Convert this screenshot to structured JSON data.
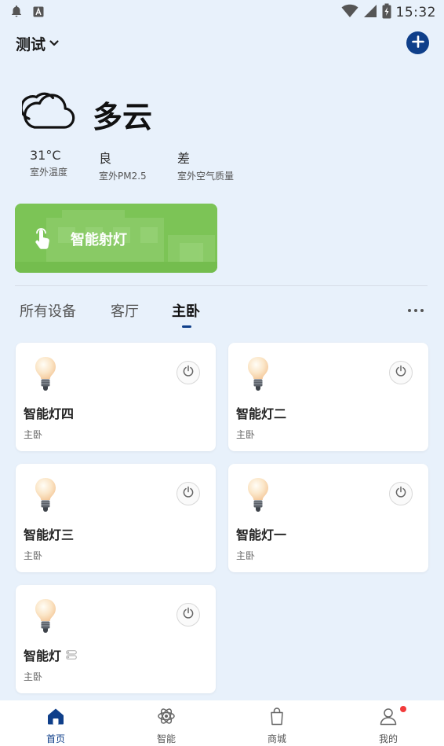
{
  "status_bar": {
    "time": "15:32",
    "icons": [
      "bell-icon",
      "app-a-icon",
      "wifi-icon",
      "signal-icon",
      "battery-charging-icon"
    ]
  },
  "header": {
    "home_name": "测试",
    "add_icon": "plus-circle-icon"
  },
  "weather": {
    "condition": "多云",
    "icon": "cloud-icon",
    "stats": [
      {
        "value": "31°C",
        "label": "室外温度"
      },
      {
        "value": "良",
        "label": "室外PM2.5"
      },
      {
        "value": "差",
        "label": "室外空气质量"
      }
    ]
  },
  "scene": {
    "label": "智能射灯",
    "icon": "tap-hand-icon",
    "color": "#7cc456"
  },
  "tabs": {
    "items": [
      "所有设备",
      "客厅",
      "主卧"
    ],
    "active_index": 2,
    "more_icon": "more-dots-icon"
  },
  "devices": [
    {
      "name": "智能灯四",
      "room": "主卧"
    },
    {
      "name": "智能灯二",
      "room": "主卧"
    },
    {
      "name": "智能灯三",
      "room": "主卧"
    },
    {
      "name": "智能灯一",
      "room": "主卧"
    },
    {
      "name": "智能灯",
      "room": "主卧",
      "group_icon": "group-toggle-icon"
    }
  ],
  "bottom_nav": {
    "items": [
      {
        "label": "首页",
        "icon": "home-icon",
        "active": true
      },
      {
        "label": "智能",
        "icon": "atom-icon",
        "active": false
      },
      {
        "label": "商城",
        "icon": "shopping-bag-icon",
        "active": false
      },
      {
        "label": "我的",
        "icon": "user-icon",
        "active": false,
        "badge": true
      }
    ]
  },
  "colors": {
    "accent": "#0f3f8a",
    "background": "#e8f1fb",
    "badge": "#f23b3b"
  }
}
